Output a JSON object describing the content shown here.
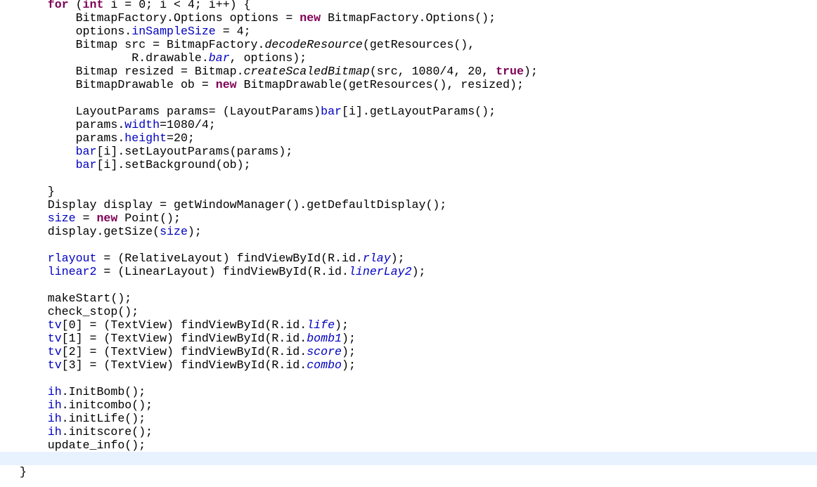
{
  "editor": {
    "current_line_index": 34,
    "colors": {
      "keyword": "#7F0055",
      "field": "#0000C0",
      "current_line": "#E8F2FE"
    },
    "lines": [
      [
        [
          "p",
          "      "
        ],
        [
          "k",
          "for"
        ],
        [
          "p",
          " ("
        ],
        [
          "k",
          "int"
        ],
        [
          "p",
          " i = 0; i < 4; i++) {"
        ]
      ],
      [
        [
          "p",
          "          BitmapFactory.Options options = "
        ],
        [
          "k",
          "new"
        ],
        [
          "p",
          " BitmapFactory.Options();"
        ]
      ],
      [
        [
          "p",
          "          options."
        ],
        [
          "f",
          "inSampleSize"
        ],
        [
          "p",
          " = 4;"
        ]
      ],
      [
        [
          "p",
          "          Bitmap src = BitmapFactory."
        ],
        [
          "s",
          "decodeResource"
        ],
        [
          "p",
          "(getResources(),"
        ]
      ],
      [
        [
          "p",
          "                  R.drawable."
        ],
        [
          "sf",
          "bar"
        ],
        [
          "p",
          ", options);"
        ]
      ],
      [
        [
          "p",
          "          Bitmap resized = Bitmap."
        ],
        [
          "s",
          "createScaledBitmap"
        ],
        [
          "p",
          "(src, 1080/4, 20, "
        ],
        [
          "k",
          "true"
        ],
        [
          "p",
          ");"
        ]
      ],
      [
        [
          "p",
          "          BitmapDrawable ob = "
        ],
        [
          "k",
          "new"
        ],
        [
          "p",
          " BitmapDrawable(getResources(), resized);"
        ]
      ],
      [
        [
          "p",
          ""
        ]
      ],
      [
        [
          "p",
          "          LayoutParams params= (LayoutParams)"
        ],
        [
          "f",
          "bar"
        ],
        [
          "p",
          "[i].getLayoutParams();"
        ]
      ],
      [
        [
          "p",
          "          params."
        ],
        [
          "f",
          "width"
        ],
        [
          "p",
          "=1080/4;"
        ]
      ],
      [
        [
          "p",
          "          params."
        ],
        [
          "f",
          "height"
        ],
        [
          "p",
          "=20;"
        ]
      ],
      [
        [
          "p",
          "          "
        ],
        [
          "f",
          "bar"
        ],
        [
          "p",
          "[i].setLayoutParams(params);"
        ]
      ],
      [
        [
          "p",
          "          "
        ],
        [
          "f",
          "bar"
        ],
        [
          "p",
          "[i].setBackground(ob);"
        ]
      ],
      [
        [
          "p",
          ""
        ]
      ],
      [
        [
          "p",
          "      }"
        ]
      ],
      [
        [
          "p",
          "      Display display = getWindowManager().getDefaultDisplay();"
        ]
      ],
      [
        [
          "p",
          "      "
        ],
        [
          "f",
          "size"
        ],
        [
          "p",
          " = "
        ],
        [
          "k",
          "new"
        ],
        [
          "p",
          " Point();"
        ]
      ],
      [
        [
          "p",
          "      display.getSize("
        ],
        [
          "f",
          "size"
        ],
        [
          "p",
          ");"
        ]
      ],
      [
        [
          "p",
          ""
        ]
      ],
      [
        [
          "p",
          "      "
        ],
        [
          "f",
          "rlayout"
        ],
        [
          "p",
          " = (RelativeLayout) findViewById(R.id."
        ],
        [
          "sf",
          "rlay"
        ],
        [
          "p",
          ");"
        ]
      ],
      [
        [
          "p",
          "      "
        ],
        [
          "f",
          "linear2"
        ],
        [
          "p",
          " = (LinearLayout) findViewById(R.id."
        ],
        [
          "sf",
          "linerLay2"
        ],
        [
          "p",
          ");"
        ]
      ],
      [
        [
          "p",
          ""
        ]
      ],
      [
        [
          "p",
          "      makeStart();"
        ]
      ],
      [
        [
          "p",
          "      check_stop();"
        ]
      ],
      [
        [
          "p",
          "      "
        ],
        [
          "f",
          "tv"
        ],
        [
          "p",
          "[0] = (TextView) findViewById(R.id."
        ],
        [
          "sf",
          "life"
        ],
        [
          "p",
          ");"
        ]
      ],
      [
        [
          "p",
          "      "
        ],
        [
          "f",
          "tv"
        ],
        [
          "p",
          "[1] = (TextView) findViewById(R.id."
        ],
        [
          "sf",
          "bomb1"
        ],
        [
          "p",
          ");"
        ]
      ],
      [
        [
          "p",
          "      "
        ],
        [
          "f",
          "tv"
        ],
        [
          "p",
          "[2] = (TextView) findViewById(R.id."
        ],
        [
          "sf",
          "score"
        ],
        [
          "p",
          ");"
        ]
      ],
      [
        [
          "p",
          "      "
        ],
        [
          "f",
          "tv"
        ],
        [
          "p",
          "[3] = (TextView) findViewById(R.id."
        ],
        [
          "sf",
          "combo"
        ],
        [
          "p",
          ");"
        ]
      ],
      [
        [
          "p",
          ""
        ]
      ],
      [
        [
          "p",
          "      "
        ],
        [
          "f",
          "ih"
        ],
        [
          "p",
          ".InitBomb();"
        ]
      ],
      [
        [
          "p",
          "      "
        ],
        [
          "f",
          "ih"
        ],
        [
          "p",
          ".initcombo();"
        ]
      ],
      [
        [
          "p",
          "      "
        ],
        [
          "f",
          "ih"
        ],
        [
          "p",
          ".initLife();"
        ]
      ],
      [
        [
          "p",
          "      "
        ],
        [
          "f",
          "ih"
        ],
        [
          "p",
          ".initscore();"
        ]
      ],
      [
        [
          "p",
          "      update_info();"
        ]
      ],
      [
        [
          "p",
          ""
        ]
      ],
      [
        [
          "p",
          "  }"
        ]
      ]
    ]
  }
}
